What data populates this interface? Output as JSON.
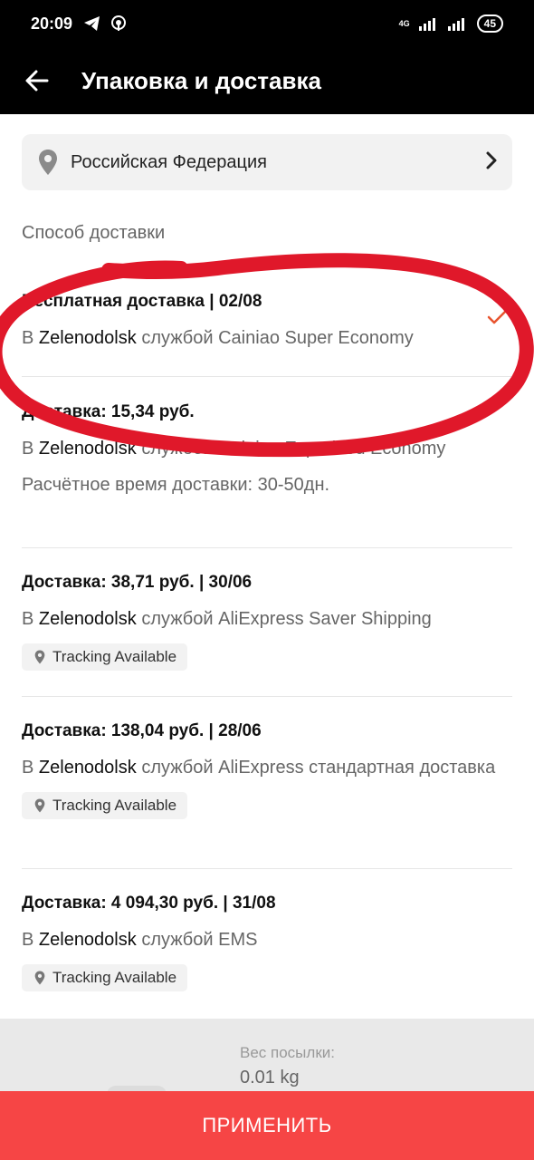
{
  "status_bar": {
    "time": "20:09",
    "network": "4G",
    "battery": "45"
  },
  "header": {
    "title": "Упаковка и доставка"
  },
  "country": {
    "name": "Российская Федерация"
  },
  "section_label": "Способ доставки",
  "options": [
    {
      "title": "Бесплатная доставка | 02/08",
      "prefix": "В",
      "city": "Zelenodolsk",
      "service": "службой Cainiao Super Economy",
      "selected": true
    },
    {
      "title": "Доставка: 15,34 руб.",
      "prefix": "В",
      "city": "Zelenodolsk",
      "service": "службой Cainiao Expedited Economy",
      "eta": "Расчётное время доставки: 30-50дн."
    },
    {
      "title": "Доставка: 38,71 руб. | 30/06",
      "prefix": "В",
      "city": "Zelenodolsk",
      "service": "службой AliExpress Saver Shipping",
      "tag": "Tracking Available"
    },
    {
      "title": "Доставка: 138,04 руб. | 28/06",
      "prefix": "В",
      "city": "Zelenodolsk",
      "service": "службой AliExpress стандартная доставка",
      "tag": "Tracking Available"
    },
    {
      "title": "Доставка: 4 094,30 руб. | 31/08",
      "prefix": "В",
      "city": "Zelenodolsk",
      "service": "службой EMS",
      "tag": "Tracking Available"
    }
  ],
  "weight": {
    "label": "Вес посылки:",
    "value": "0.01 kg"
  },
  "apply_button": "ПРИМЕНИТЬ",
  "colors": {
    "accent": "#f64545",
    "check": "#e8542f",
    "annotation": "#e0182a"
  }
}
